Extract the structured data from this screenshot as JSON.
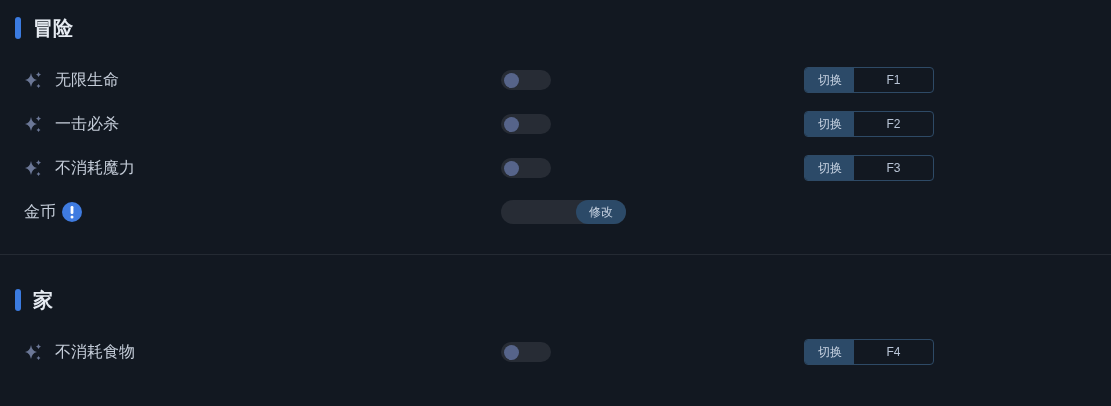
{
  "sections": [
    {
      "title": "冒险",
      "rows": [
        {
          "kind": "toggle",
          "label": "无限生命",
          "on": false,
          "hotkey_action": "切换",
          "hotkey": "F1"
        },
        {
          "kind": "toggle",
          "label": "一击必杀",
          "on": false,
          "hotkey_action": "切换",
          "hotkey": "F2"
        },
        {
          "kind": "toggle",
          "label": "不消耗魔力",
          "on": false,
          "hotkey_action": "切换",
          "hotkey": "F3"
        },
        {
          "kind": "input",
          "label": "金币",
          "info": true,
          "button": "修改"
        }
      ]
    },
    {
      "title": "家",
      "rows": [
        {
          "kind": "toggle",
          "label": "不消耗食物",
          "on": false,
          "hotkey_action": "切换",
          "hotkey": "F4"
        }
      ]
    }
  ]
}
